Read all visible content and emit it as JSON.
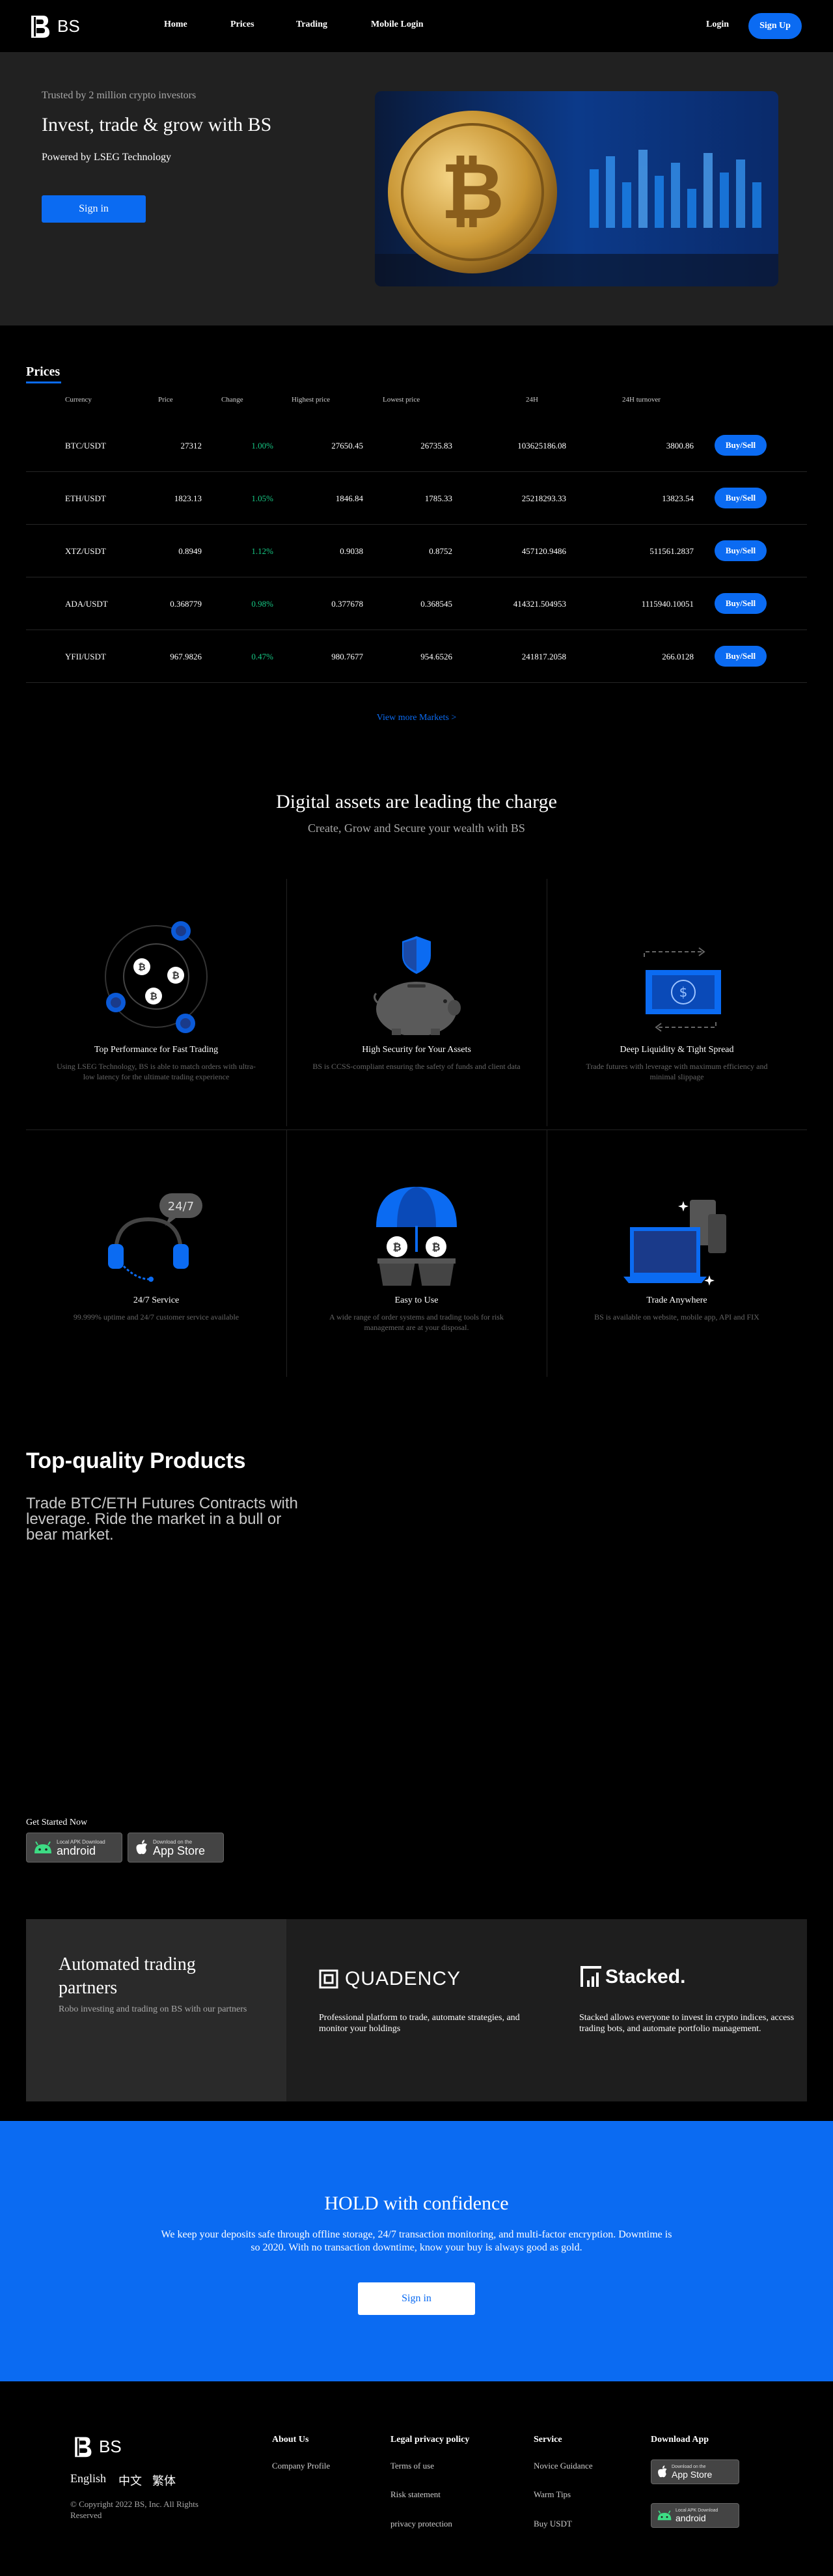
{
  "nav": {
    "brand": "BS",
    "links": [
      "Home",
      "Prices",
      "Trading",
      "Mobile Login"
    ],
    "login": "Login",
    "signup": "Sign Up"
  },
  "hero": {
    "trusted": "Trusted by 2 million crypto investors",
    "title": "Invest, trade & grow with BS",
    "powered": "Powered by LSEG Technology",
    "cta": "Sign in"
  },
  "prices": {
    "title": "Prices",
    "headers": [
      "Currency",
      "Price",
      "Change",
      "Highest price",
      "Lowest price",
      "24H",
      "24H turnover"
    ],
    "rows": [
      {
        "pair": "BTC/USDT",
        "price": "27312",
        "change": "1.00%",
        "high": "27650.45",
        "low": "26735.83",
        "vol": "103625186.08",
        "turnover": "3800.86"
      },
      {
        "pair": "ETH/USDT",
        "price": "1823.13",
        "change": "1.05%",
        "high": "1846.84",
        "low": "1785.33",
        "vol": "25218293.33",
        "turnover": "13823.54"
      },
      {
        "pair": "XTZ/USDT",
        "price": "0.8949",
        "change": "1.12%",
        "high": "0.9038",
        "low": "0.8752",
        "vol": "457120.9486",
        "turnover": "511561.2837"
      },
      {
        "pair": "ADA/USDT",
        "price": "0.368779",
        "change": "0.98%",
        "high": "0.377678",
        "low": "0.368545",
        "vol": "414321.504953",
        "turnover": "1115940.10051"
      },
      {
        "pair": "YFII/USDT",
        "price": "967.9826",
        "change": "0.47%",
        "high": "980.7677",
        "low": "954.6526",
        "vol": "241817.2058",
        "turnover": "266.0128"
      }
    ],
    "buy_label": "Buy/Sell",
    "view_more": "View more Markets >"
  },
  "features": {
    "title": "Digital assets are leading the charge",
    "subtitle": "Create, Grow and Secure your wealth with BS",
    "items": [
      {
        "name": "Top Performance for Fast Trading",
        "desc": "Using LSEG Technology, BS is able to match orders with ultra-low latency for the ultimate trading experience",
        "icon": "orbit-coins-icon"
      },
      {
        "name": "High Security for Your Assets",
        "desc": "BS is CCSS-compliant ensuring the safety of funds and client data",
        "icon": "piggy-bank-shield-icon"
      },
      {
        "name": "Deep Liquidity & Tight Spread",
        "desc": "Trade futures with leverage with maximum efficiency and minimal slippage",
        "icon": "exchange-bill-icon"
      },
      {
        "name": "24/7 Service",
        "desc": "99.999% uptime and 24/7 customer service available",
        "icon": "headset-icon"
      },
      {
        "name": "Easy to Use",
        "desc": "A wide range of order systems and trading tools for risk management are at your disposal.",
        "icon": "umbrella-coins-icon"
      },
      {
        "name": "Trade Anywhere",
        "desc": "BS is available on website, mobile app, API and FIX",
        "icon": "devices-icon"
      }
    ],
    "badge_247": "24/7"
  },
  "products": {
    "title": "Top-quality Products",
    "text": "Trade BTC/ETH Futures Contracts with leverage. Ride the market in a bull or bear market.",
    "get_started": "Get Started Now",
    "android_small": "Local APK Download",
    "android_big": "android",
    "ios_small": "Download on the",
    "ios_big": "App Store"
  },
  "automated": {
    "title": "Automated trading partners",
    "desc": "Robo investing and trading on BS with our partners",
    "partners": [
      {
        "name": "QUADENCY",
        "desc": "Professional platform to trade, automate strategies, and monitor your holdings"
      },
      {
        "name": "Stacked.",
        "desc": "Stacked allows everyone to invest in crypto indices, access trading bots, and automate portfolio management."
      }
    ]
  },
  "hold": {
    "title": "HOLD with confidence",
    "text": "We keep your deposits safe through offline storage, 24/7 transaction monitoring, and multi-factor encryption. Downtime is so 2020. With no transaction downtime, know your buy is always good as gold.",
    "cta": "Sign in"
  },
  "footer": {
    "brand": "BS",
    "langs": [
      "English",
      "中文",
      "繁体"
    ],
    "copyright": "© Copyright 2022 BS, Inc. All Rights Reserved",
    "cols": [
      {
        "title": "About Us",
        "links": [
          "Company Profile"
        ]
      },
      {
        "title": "Legal privacy policy",
        "links": [
          "Terms of use",
          "Risk statement",
          "privacy protection"
        ]
      },
      {
        "title": "Service",
        "links": [
          "Novice Guidance",
          "Warm Tips",
          "Buy USDT"
        ]
      }
    ],
    "download_title": "Download App"
  },
  "colors": {
    "accent": "#0b6bf2",
    "positive": "#17c784",
    "hero_bg": "#212121"
  }
}
